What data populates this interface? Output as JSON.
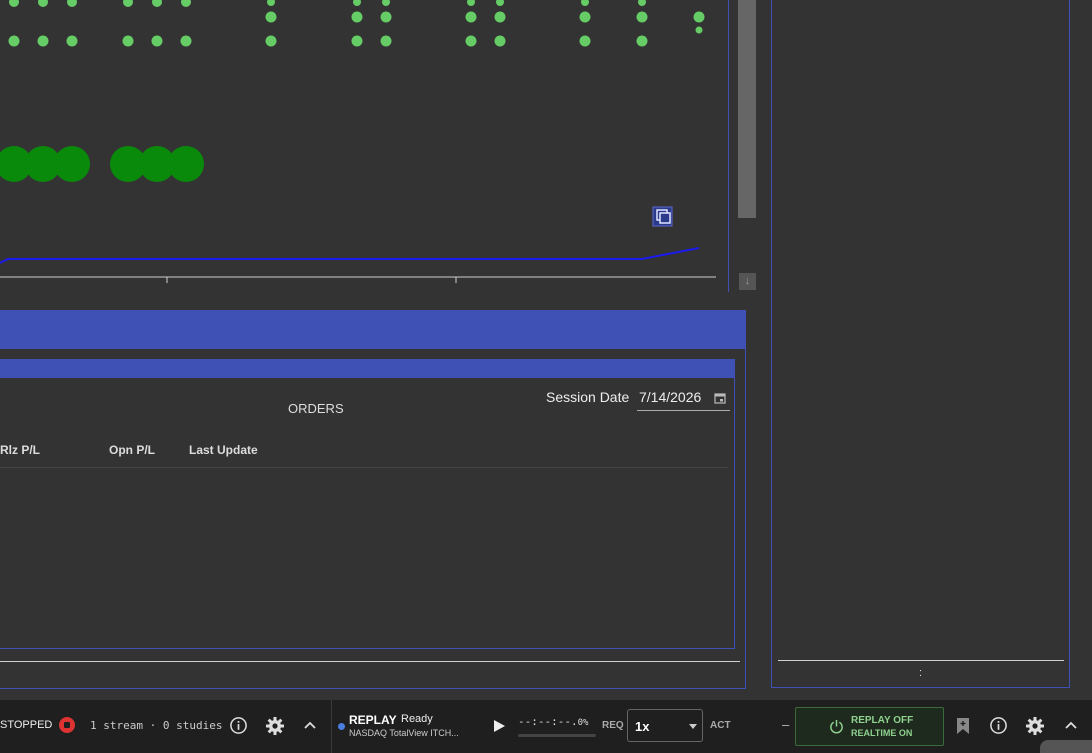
{
  "orders": {
    "title": "ORDERS",
    "session_label": "Session Date",
    "session_date": "7/14/2026",
    "columns": [
      "Rlz P/L",
      "Opn P/L",
      "Last Update"
    ]
  },
  "right_panel": {
    "handle": ":"
  },
  "statusbar": {
    "state": "STOPPED",
    "streams": "1 stream · 0 studies",
    "replay_label": "REPLAY",
    "replay_status": "Ready",
    "feed": "NASDAQ TotalView ITCH...",
    "time": "--:--:--.",
    "percent": "0%",
    "req": "REQ",
    "speed": "1x",
    "act": "ACT",
    "dash": "–",
    "toggle_line1": "REPLAY OFF",
    "toggle_line2": "REALTIME ON"
  },
  "colors": {
    "accent": "#3f51b5",
    "dots": "#66cc66",
    "bubbles": "#0a8a0a",
    "line": "#1a1aee",
    "record": "#dd3333"
  },
  "icons": [
    "record-icon",
    "info-icon",
    "gear-icon",
    "chevron-up-icon",
    "play-icon",
    "power-icon",
    "bookmark-icon",
    "calendar-icon",
    "layers-icon",
    "arrow-down-icon"
  ]
}
